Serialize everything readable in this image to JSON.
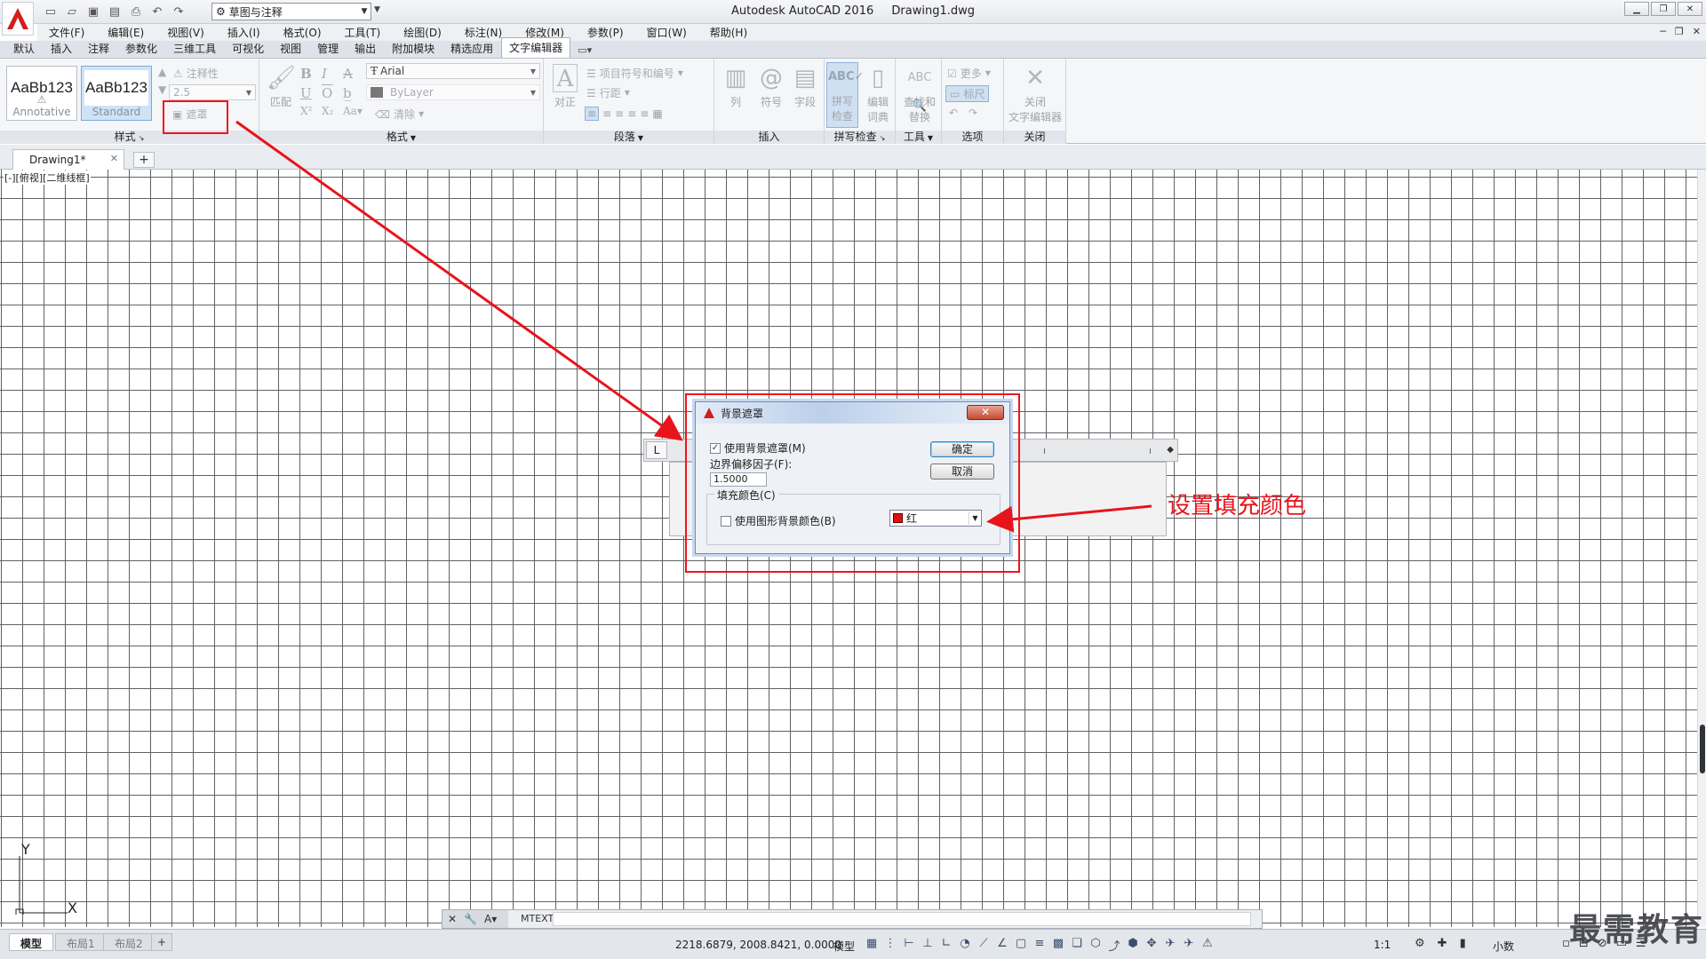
{
  "app": {
    "title": "Autodesk AutoCAD 2016",
    "document": "Drawing1.dwg",
    "workspace": "草图与注释"
  },
  "menu": [
    "文件(F)",
    "编辑(E)",
    "视图(V)",
    "插入(I)",
    "格式(O)",
    "工具(T)",
    "绘图(D)",
    "标注(N)",
    "修改(M)",
    "参数(P)",
    "窗口(W)",
    "帮助(H)"
  ],
  "ribbon_tabs": [
    "默认",
    "插入",
    "注释",
    "参数化",
    "三维工具",
    "可视化",
    "视图",
    "管理",
    "输出",
    "附加模块",
    "精选应用",
    "文字编辑器"
  ],
  "active_ribbon_tab": "文字编辑器",
  "ribbon": {
    "style": {
      "title": "样式",
      "tiles": [
        {
          "sample": "AaBb123",
          "name": "Annotative"
        },
        {
          "sample": "AaBb123",
          "name": "Standard"
        }
      ],
      "annotative": "注释性",
      "height": "2.5",
      "mask": "遮罩"
    },
    "format": {
      "title": "格式",
      "match": "匹配",
      "font": "Arial",
      "color": "ByLayer",
      "clear": "清除"
    },
    "paragraph": {
      "title": "段落",
      "justify": "对正",
      "bullets": "项目符号和编号",
      "line_spacing": "行距"
    },
    "insert": {
      "title": "插入",
      "columns": "列",
      "symbol": "符号",
      "field": "字段"
    },
    "spell": {
      "title": "拼写检查",
      "spell_check_1": "拼写",
      "spell_check_2": "检查",
      "edit_dict_1": "编辑",
      "edit_dict_2": "词典"
    },
    "tools": {
      "title": "工具",
      "find_1": "查找和",
      "find_2": "替换"
    },
    "options": {
      "title": "选项",
      "more": "更多",
      "ruler": "标尺"
    },
    "close": {
      "title": "关闭",
      "close_1": "关闭",
      "close_2": "文字编辑器"
    }
  },
  "doc_tab": "Drawing1*",
  "viewport_label": "[-][俯视][二维线框]",
  "dialog": {
    "title": "背景遮罩",
    "use_mask": "使用背景遮罩(M)",
    "use_mask_checked": true,
    "offset_label": "边界偏移因子(F):",
    "offset_value": "1.5000",
    "fill_group": "填充颜色(C)",
    "use_bg_color": "使用图形背景颜色(B)",
    "use_bg_color_checked": false,
    "color_value": "红",
    "color_hex": "#e01010",
    "ok": "确定",
    "cancel": "取消"
  },
  "annotation": "设置填充颜色",
  "command": {
    "text": "MTEXT"
  },
  "status": {
    "layouts": [
      "模型",
      "布局1",
      "布局2"
    ],
    "coords": "2218.6879, 2008.8421, 0.0000",
    "model": "模型",
    "scale": "1:1",
    "units": "小数"
  },
  "watermark": "最需教育",
  "ucs": {
    "y": "Y",
    "x": "X"
  },
  "colors": {
    "highlight": "#f0141b",
    "ribbon_active": "#cfe0f2"
  }
}
